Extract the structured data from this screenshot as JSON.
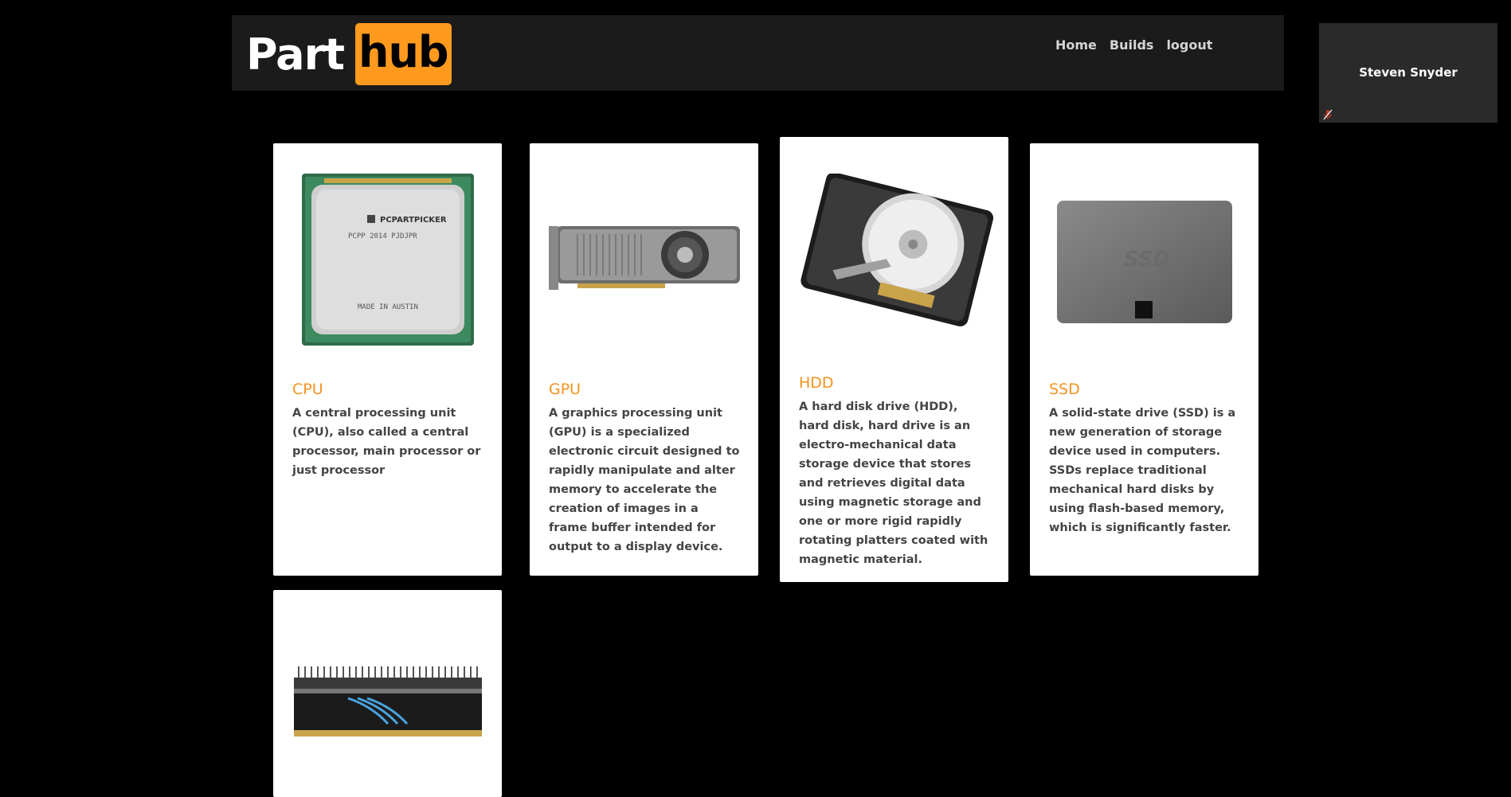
{
  "brand": {
    "part": "Part",
    "hub": "hub"
  },
  "nav": {
    "home": "Home",
    "builds": "Builds",
    "logout": "logout"
  },
  "user": {
    "name": "Steven Snyder"
  },
  "colors": {
    "accent": "#f6921e",
    "brand_bg": "#ff9a1f",
    "navbar": "#1b1b1b"
  },
  "cards": [
    {
      "title": "CPU",
      "text": "A central processing unit (CPU), also called a central processor, main processor or just processor",
      "image": "cpu-image"
    },
    {
      "title": "GPU",
      "text": "A graphics processing unit (GPU) is a specialized electronic circuit designed to rapidly manipulate and alter memory to accelerate the creation of images in a frame buffer intended for output to a display device.",
      "image": "gpu-image"
    },
    {
      "title": "HDD",
      "text": "A hard disk drive (HDD), hard disk, hard drive is an electro-mechanical data storage device that stores and retrieves digital data using magnetic storage and one or more rigid rapidly rotating platters coated with magnetic material.",
      "image": "hdd-image"
    },
    {
      "title": "SSD",
      "text": "A solid-state drive (SSD) is a new generation of storage device used in computers. SSDs replace traditional mechanical hard disks by using flash-based memory, which is significantly faster.",
      "image": "ssd-image"
    },
    {
      "title": "",
      "text": "",
      "image": "ram-image"
    }
  ]
}
